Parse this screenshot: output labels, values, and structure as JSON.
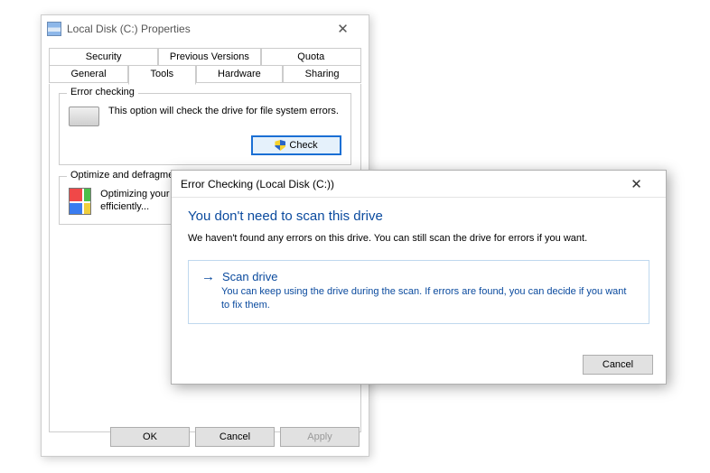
{
  "properties": {
    "title": "Local Disk (C:) Properties",
    "tabs_row1": [
      {
        "label": "Security"
      },
      {
        "label": "Previous Versions"
      },
      {
        "label": "Quota"
      }
    ],
    "tabs_row2": [
      {
        "label": "General"
      },
      {
        "label": "Tools",
        "active": true
      },
      {
        "label": "Hardware"
      },
      {
        "label": "Sharing"
      }
    ],
    "error_checking": {
      "legend": "Error checking",
      "text": "This option will check the drive for file system errors.",
      "button": "Check"
    },
    "defrag": {
      "legend": "Optimize and defragment drive",
      "text": "Optimizing your computer's drives can help it run more efficiently..."
    },
    "footer": {
      "ok": "OK",
      "cancel": "Cancel",
      "apply": "Apply"
    }
  },
  "error_dialog": {
    "title": "Error Checking (Local Disk (C:))",
    "headline": "You don't need to scan this drive",
    "subtext": "We haven't found any errors on this drive. You can still scan the drive for errors if you want.",
    "scan": {
      "title": "Scan drive",
      "desc": "You can keep using the drive during the scan. If errors are found, you can decide if you want to fix them."
    },
    "cancel": "Cancel"
  }
}
